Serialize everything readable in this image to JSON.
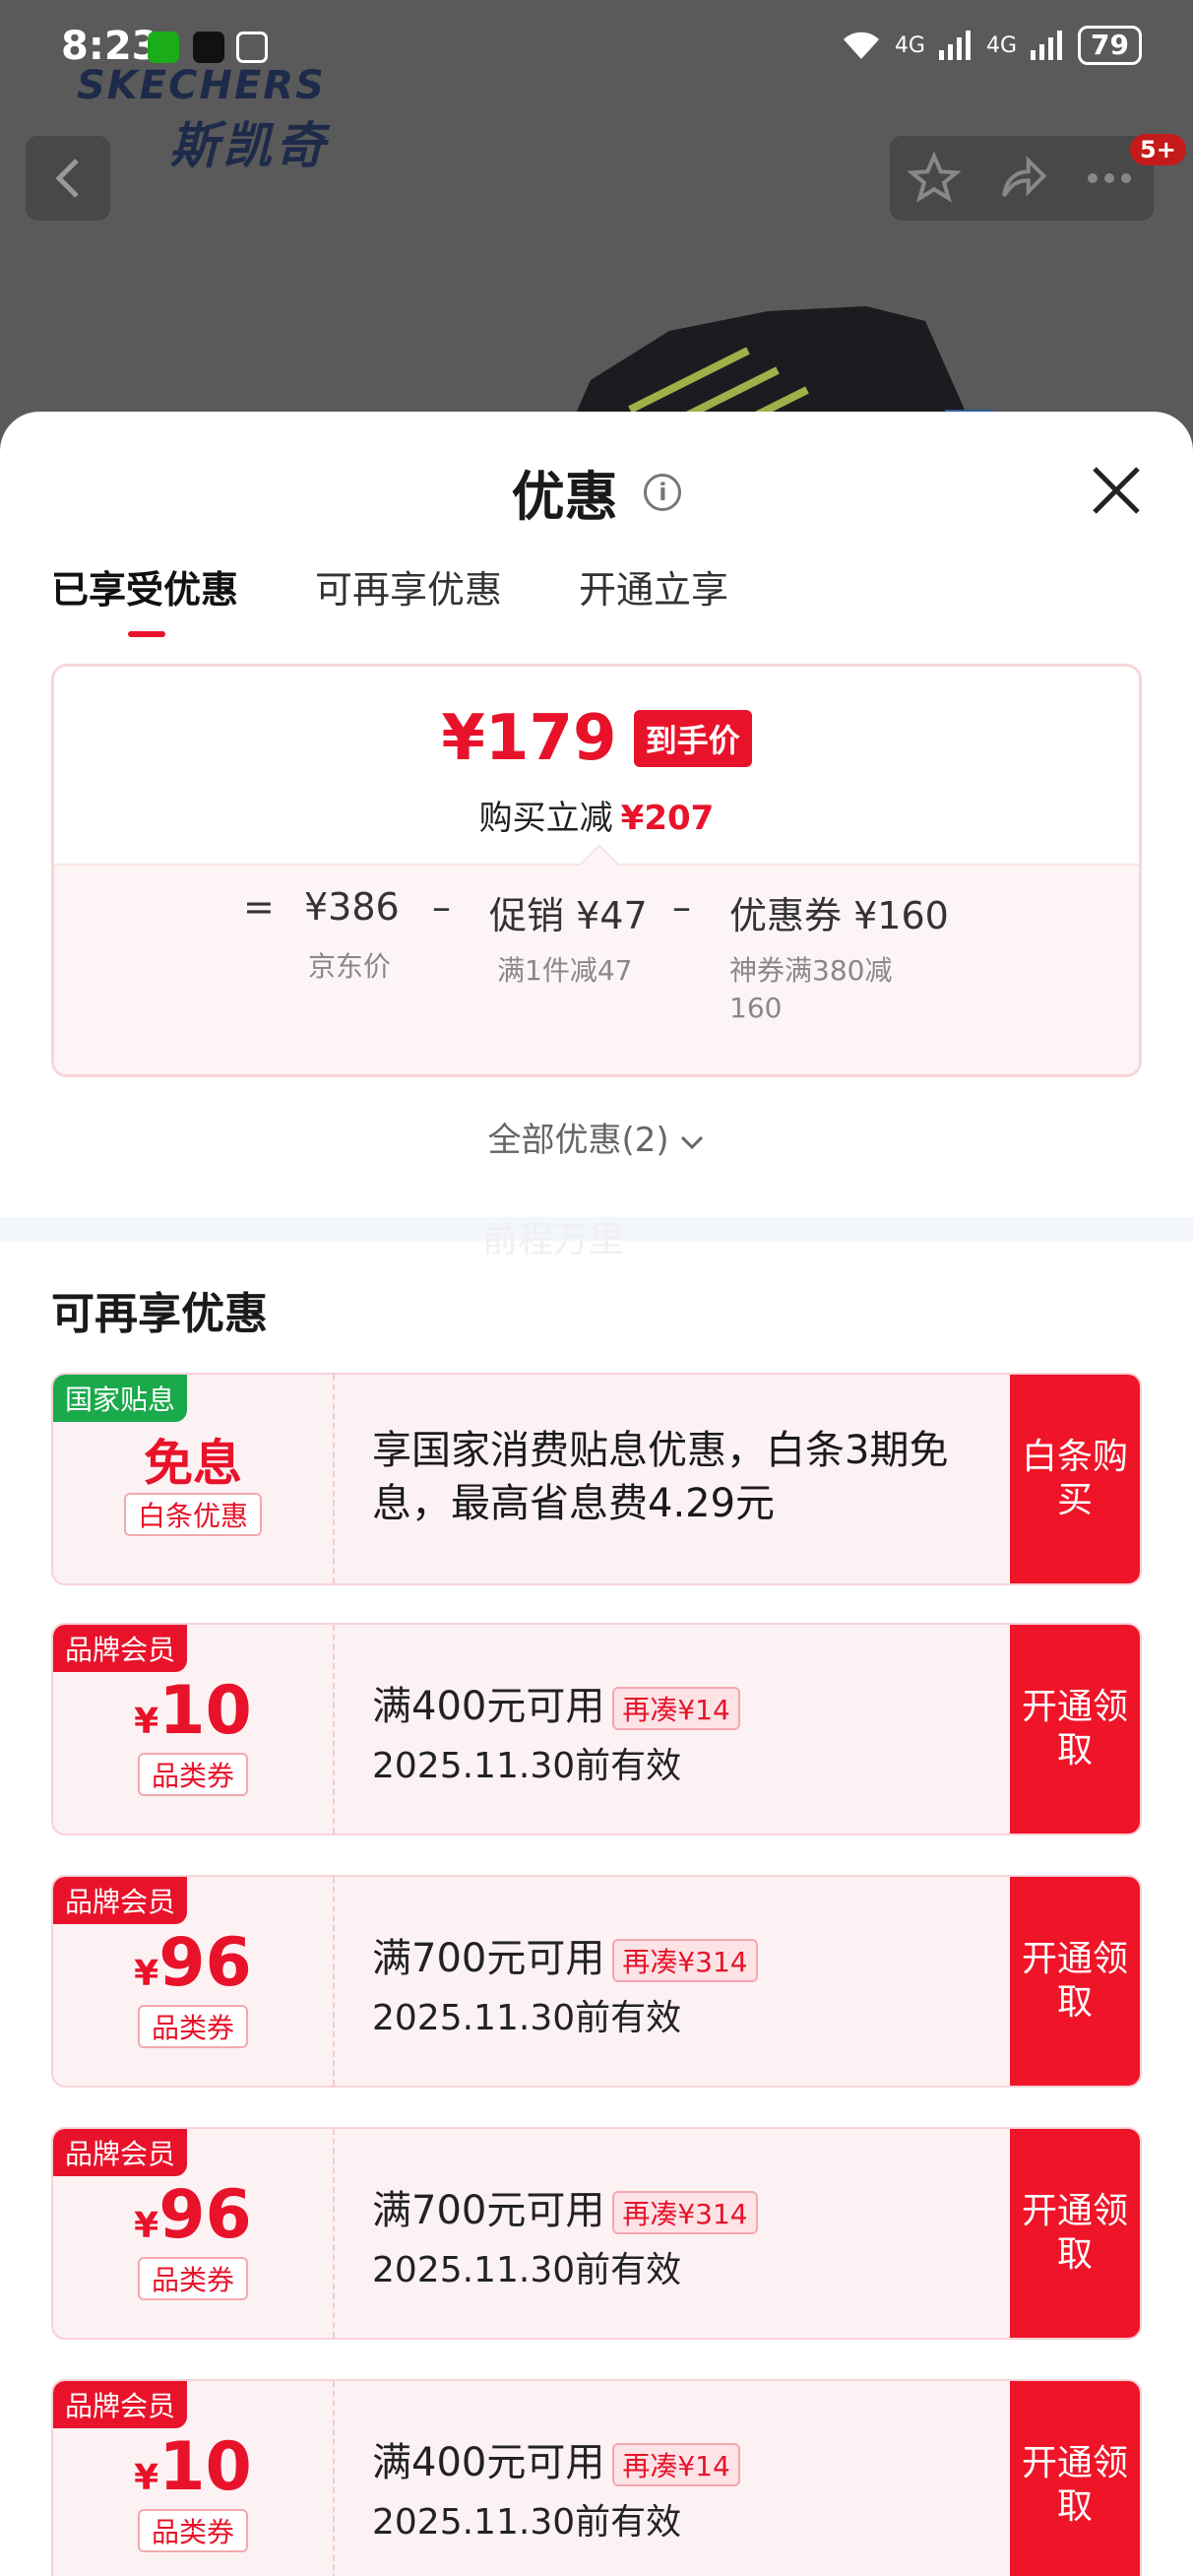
{
  "status_bar": {
    "time": "8:23",
    "battery": "79",
    "net1": "4G",
    "net2": "4G"
  },
  "brand": {
    "logo_en": "SKECHERS",
    "logo_cn": "斯凯奇"
  },
  "header": {
    "cart_badge": "5+"
  },
  "sheet": {
    "title": "优惠",
    "tabs": [
      "已享受优惠",
      "可再享优惠",
      "开通立享"
    ]
  },
  "price_card": {
    "final_price": "¥179",
    "final_tag": "到手价",
    "reduce_label": "购买立减",
    "reduce_amount": "¥207",
    "eq": "=",
    "minus": "–",
    "jd_price": "¥386",
    "jd_price_label": "京东价",
    "promo_label": "促销",
    "promo_amount": "¥47",
    "promo_desc": "满1件减47",
    "coupon_label": "优惠券",
    "coupon_amount": "¥160",
    "coupon_desc": "神券满380减160"
  },
  "all_promos": "全部优惠(2)",
  "watermark": "前程万里",
  "more_section": {
    "title": "可再享优惠",
    "interest": {
      "tag": "国家贴息",
      "amount": "免息",
      "type": "白条优惠",
      "text": "享国家消费贴息优惠，白条3期免息，最高省息费4.29元",
      "button": "白条购买"
    },
    "coupons": [
      {
        "tag": "品牌会员",
        "amount": "10",
        "type": "品类券",
        "cond": "满400元可用",
        "extra": "再凑¥14",
        "valid": "2025.11.30前有效",
        "button": "开通领取"
      },
      {
        "tag": "品牌会员",
        "amount": "96",
        "type": "品类券",
        "cond": "满700元可用",
        "extra": "再凑¥314",
        "valid": "2025.11.30前有效",
        "button": "开通领取"
      },
      {
        "tag": "品牌会员",
        "amount": "96",
        "type": "品类券",
        "cond": "满700元可用",
        "extra": "再凑¥314",
        "valid": "2025.11.30前有效",
        "button": "开通领取"
      },
      {
        "tag": "品牌会员",
        "amount": "10",
        "type": "品类券",
        "cond": "满400元可用",
        "extra": "再凑¥14",
        "valid": "2025.11.30前有效",
        "button": "开通领取"
      }
    ],
    "yen": "¥"
  },
  "colors": {
    "accent": "#e8132a",
    "tag_green": "#1aaa4b",
    "tag_red": "#e8132a"
  }
}
